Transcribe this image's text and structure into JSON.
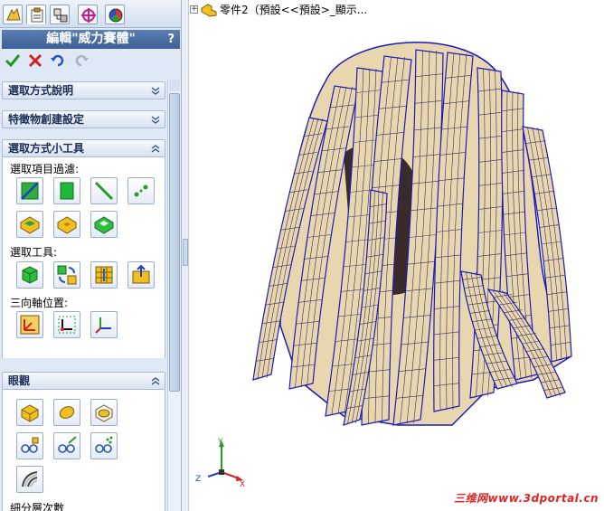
{
  "tabs": [
    {
      "name": "feature-manager"
    },
    {
      "name": "property-manager"
    },
    {
      "name": "configuration-manager"
    },
    {
      "name": "dimxpert-manager"
    },
    {
      "name": "display-manager"
    }
  ],
  "property_manager": {
    "title": "編輯\"威力賽體\"",
    "help": "?",
    "actions": [
      "ok",
      "cancel",
      "undo",
      "redo"
    ]
  },
  "groups": {
    "selection_help": {
      "label": "選取方式說明"
    },
    "feature_creation": {
      "label": "特徵物創建設定"
    },
    "selection_tools_group": {
      "label": "選取方式小工具",
      "filter_label": "選取項目過濾:",
      "tools_label": "選取工具:",
      "triad_label": "三向軸位置:"
    },
    "display": {
      "label": "眼觀",
      "subdivision_label": "細分層次數"
    }
  },
  "document": {
    "expand": "+",
    "tree_text": "零件2（預設<<預設>_顯示..."
  },
  "triad": {
    "x": "X",
    "y": "Y",
    "z": "Z"
  },
  "watermark": "三维网www.3dportal.cn",
  "colors": {
    "accent": "#3c5f95",
    "panel": "#dfe8f5",
    "mesh_face": "#e8d6ae",
    "mesh_edge": "#1b1bb8"
  }
}
